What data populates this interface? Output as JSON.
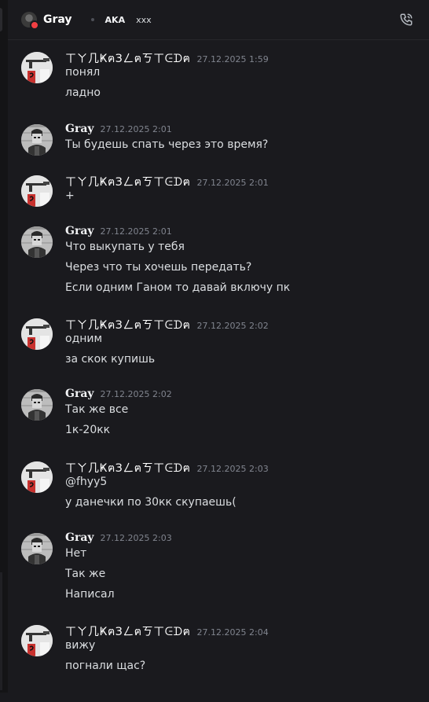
{
  "header": {
    "username": "Gray",
    "aka_label": "AKA",
    "aka_value": "xxx"
  },
  "colors": {
    "background": "#1a1a1e",
    "status_dnd": "#f23f43",
    "timestamp": "#80848e"
  },
  "messages": [
    {
      "author": "ㄒㄚ几ҜฅЗㄥฅㄎㄒᕮᗪฅ",
      "time": "27.12.2025 1:59",
      "lines": [
        "понял",
        "ладно"
      ]
    },
    {
      "author": "Gray",
      "time": "27.12.2025 2:01",
      "lines": [
        "Ты будешь спать через это время?"
      ]
    },
    {
      "author": "ㄒㄚ几ҜฅЗㄥฅㄎㄒᕮᗪฅ",
      "time": "27.12.2025 2:01",
      "lines": [
        "+"
      ]
    },
    {
      "author": "Gray",
      "time": "27.12.2025 2:01",
      "lines": [
        "Что выкупать у тебя",
        "Через что ты хочешь передать?",
        "Если одним Ганом то давай включу пк"
      ]
    },
    {
      "author": "ㄒㄚ几ҜฅЗㄥฅㄎㄒᕮᗪฅ",
      "time": "27.12.2025 2:02",
      "lines": [
        "одним",
        "за скок купишь"
      ]
    },
    {
      "author": "Gray",
      "time": "27.12.2025 2:02",
      "lines": [
        "Так же все",
        "1к-20кк"
      ]
    },
    {
      "author": "ㄒㄚ几ҜฅЗㄥฅㄎㄒᕮᗪฅ",
      "time": "27.12.2025 2:03",
      "lines": [
        "@fhyy5",
        "у данечки по 30кк скупаешь("
      ]
    },
    {
      "author": "Gray",
      "time": "27.12.2025 2:03",
      "lines": [
        "Нет",
        "Так же",
        "Написал"
      ]
    },
    {
      "author": "ㄒㄚ几ҜฅЗㄥฅㄎㄒᕮᗪฅ",
      "time": "27.12.2025 2:04",
      "lines": [
        "вижу",
        "погнали щас?"
      ]
    }
  ]
}
